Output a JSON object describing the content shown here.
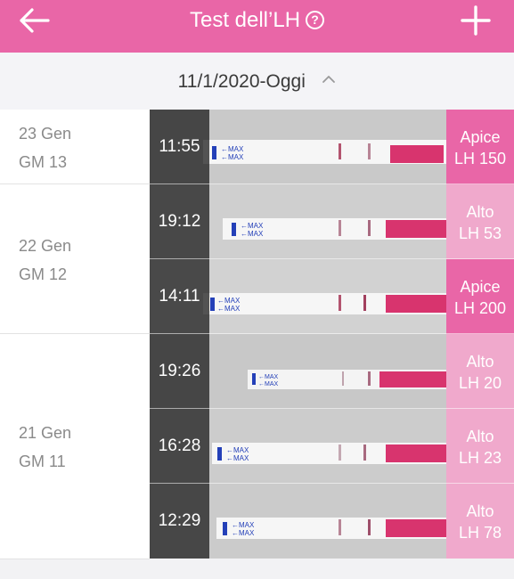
{
  "header": {
    "title": "Test dell’LH",
    "help_icon": "question-circle-icon",
    "back_icon": "arrow-left-icon",
    "add_icon": "plus-icon",
    "color": "#e966a7"
  },
  "date_range": {
    "label": "11/1/2020-Oggi",
    "icon": "chevron-up-icon"
  },
  "colors": {
    "peak": "#e966a7",
    "high": "#f0a9cc"
  },
  "days": [
    {
      "date": "23 Gen",
      "cycle_day": "GM 13"
    },
    {
      "date": "22 Gen",
      "cycle_day": "GM 12"
    },
    {
      "date": "21 Gen",
      "cycle_day": "GM 11"
    }
  ],
  "tests": [
    {
      "time": "11:55",
      "level": "Apice",
      "value": "LH 150"
    },
    {
      "time": "19:12",
      "level": "Alto",
      "value": "LH 53"
    },
    {
      "time": "14:11",
      "level": "Apice",
      "value": "LH 200"
    },
    {
      "time": "19:26",
      "level": "Alto",
      "value": "LH 20"
    },
    {
      "time": "16:28",
      "level": "Alto",
      "value": "LH 23"
    },
    {
      "time": "12:29",
      "level": "Alto",
      "value": "LH 78"
    }
  ]
}
